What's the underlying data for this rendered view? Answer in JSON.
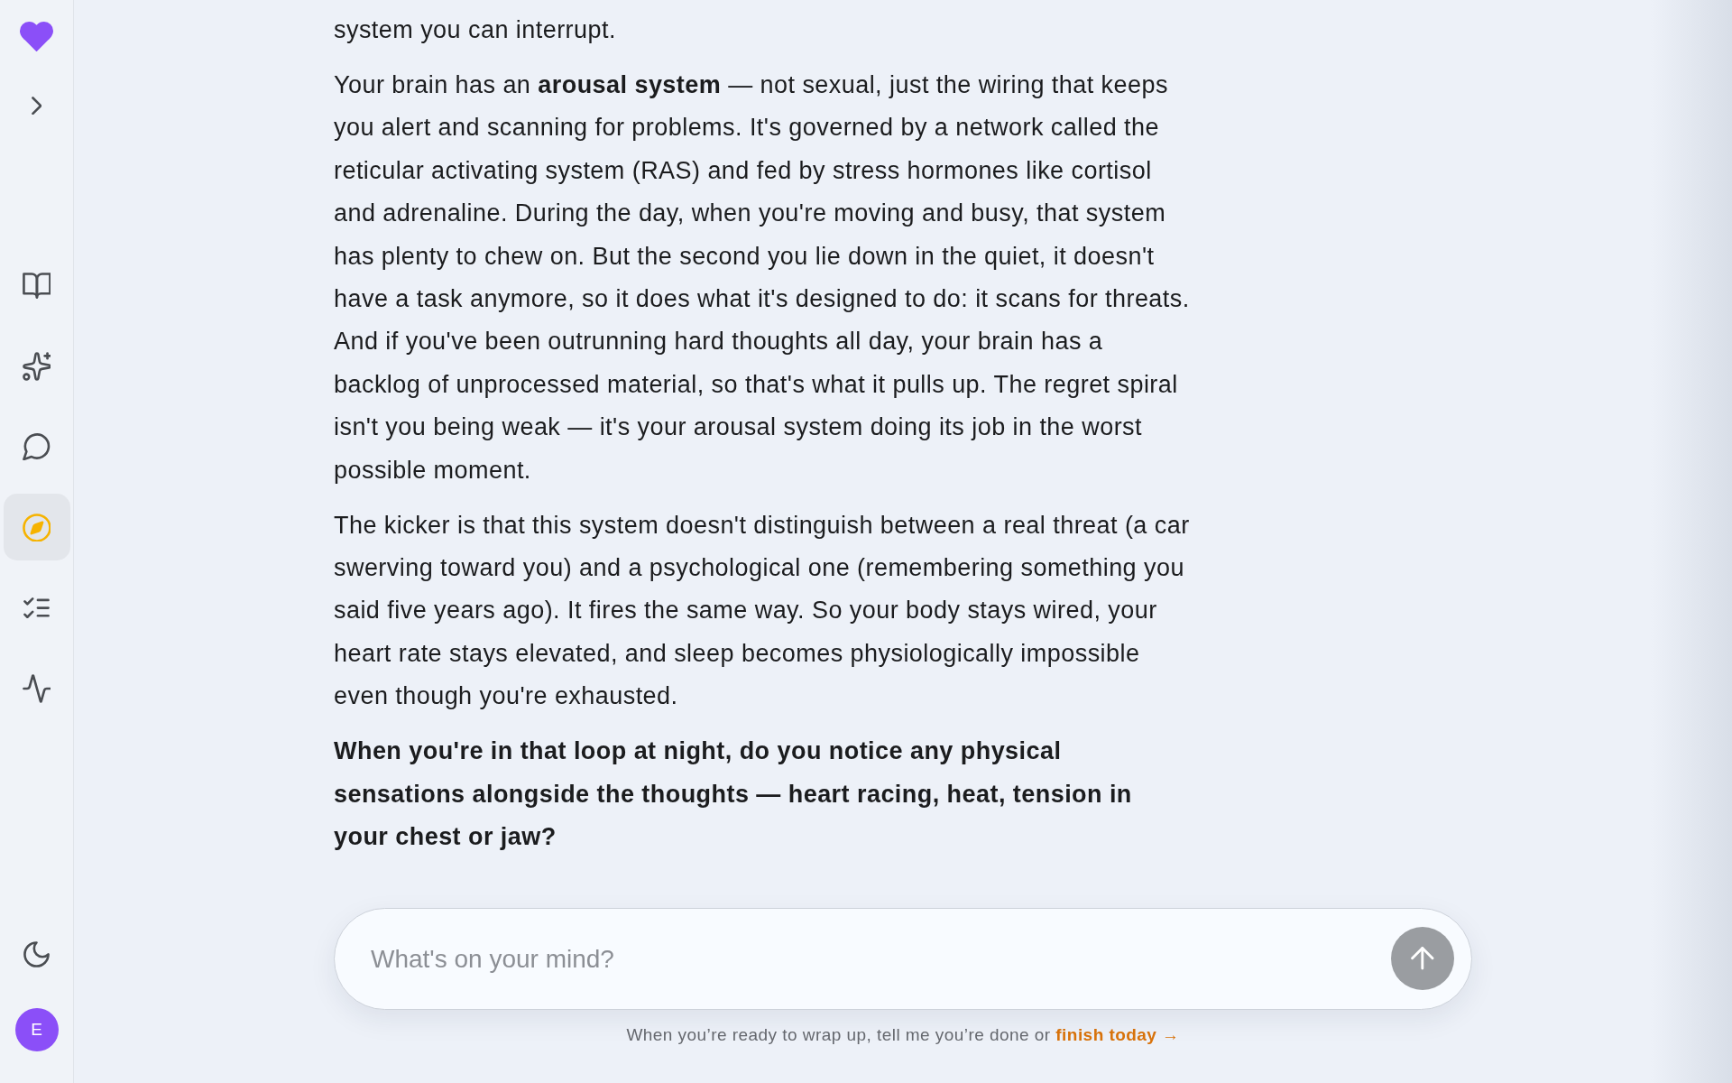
{
  "sidebar": {
    "nav": [
      {
        "kind": "book",
        "selected": false
      },
      {
        "kind": "sparkles",
        "selected": false
      },
      {
        "kind": "chat",
        "selected": false
      },
      {
        "kind": "compass",
        "selected": true
      },
      {
        "kind": "checklist",
        "selected": false
      },
      {
        "kind": "pulse",
        "selected": false
      }
    ],
    "avatar": {
      "initial": "E"
    }
  },
  "conversation": {
    "paragraphs": [
      {
        "kind": "text",
        "text": "system you can interrupt."
      },
      {
        "kind": "text",
        "text": "Your brain has an **arousal system** — not sexual, just the wiring that keeps you alert and scanning for problems. It's governed by a network called the reticular activating system (RAS) and fed by stress hormones like cortisol and adrenaline. During the day, when you're moving and busy, that system has plenty to chew on. But the second you lie down in the quiet, it doesn't have a task anymore, so it does what it's designed to do: it scans for threats. And if you've been outrunning hard thoughts all day, your brain has a backlog of unprocessed material, so that's what it pulls up. The regret spiral isn't you being weak — it's your arousal system doing its job in the worst possible moment."
      },
      {
        "kind": "text",
        "text": "The kicker is that this system doesn't distinguish between a real threat (a car swerving toward you) and a psychological one (remembering something you said five years ago). It fires the same way. So your body stays wired, your heart rate stays elevated, and sleep becomes physiologically impossible even though you're exhausted."
      },
      {
        "kind": "question",
        "text": "When you're in that loop at night, do you notice any physical sensations alongside the thoughts — heart racing, heat, tension in your chest or jaw?"
      }
    ]
  },
  "composer": {
    "placeholder": "What's on your mind?",
    "send_disabled": true
  },
  "footer": {
    "text": "When you’re ready to wrap up, tell me you’re done or",
    "link": "finish today →"
  }
}
